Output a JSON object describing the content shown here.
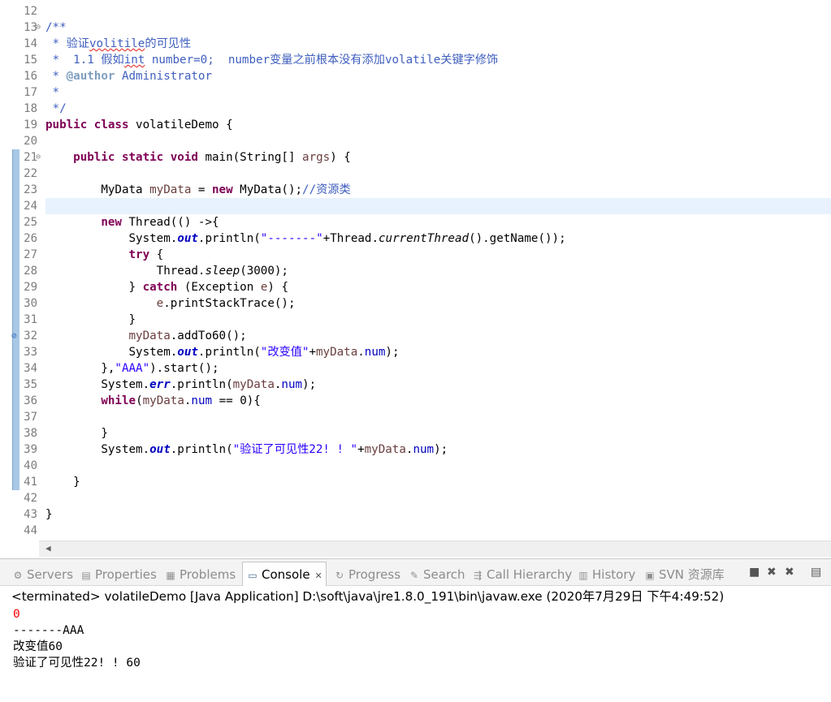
{
  "editor": {
    "line_numbers": [
      "12",
      "13",
      "14",
      "15",
      "16",
      "17",
      "18",
      "19",
      "20",
      "21",
      "22",
      "23",
      "24",
      "25",
      "26",
      "27",
      "28",
      "29",
      "30",
      "31",
      "32",
      "33",
      "34",
      "35",
      "36",
      "37",
      "38",
      "39",
      "40",
      "41",
      "42",
      "43",
      "44"
    ],
    "lines": {
      "l13": "/**",
      "l14a": " * 验证",
      "l14b": "volitile",
      "l14c": "的可见性",
      "l15a": " *  1.1 假如",
      "l15b": "int",
      "l15c": " number=0;  number变量之前根本没有添加volatile关键字修饰",
      "l16a": " * ",
      "l16b": "@author",
      "l16c": " Administrator",
      "l17": " *",
      "l18": " */",
      "l19a": "public class",
      "l19b": " volatileDemo {",
      "l21a": "    ",
      "l21b": "public static void",
      "l21c": " main(String[] ",
      "l21d": "args",
      "l21e": ") {",
      "l23a": "        MyData ",
      "l23b": "myData",
      "l23c": " = ",
      "l23d": "new",
      "l23e": " MyData();",
      "l23f": "//资源类",
      "l25a": "        ",
      "l25b": "new",
      "l25c": " Thread(() ->{",
      "l26a": "            System.",
      "l26b": "out",
      "l26c": ".println(",
      "l26d": "\"-------\"",
      "l26e": "+Thread.",
      "l26f": "currentThread",
      "l26g": "().getName());",
      "l27a": "            ",
      "l27b": "try",
      "l27c": " {",
      "l28a": "                Thread.",
      "l28b": "sleep",
      "l28c": "(3000);",
      "l29a": "            } ",
      "l29b": "catch",
      "l29c": " (Exception ",
      "l29d": "e",
      "l29e": ") {",
      "l30a": "                ",
      "l30b": "e",
      "l30c": ".printStackTrace();",
      "l31": "            }",
      "l32a": "            ",
      "l32b": "myData",
      "l32c": ".addTo60();",
      "l33a": "            System.",
      "l33b": "out",
      "l33c": ".println(",
      "l33d": "\"改变值\"",
      "l33e": "+",
      "l33f": "myData",
      "l33g": ".",
      "l33h": "num",
      "l33i": ");",
      "l34a": "        },",
      "l34b": "\"AAA\"",
      "l34c": ").start();",
      "l35a": "        System.",
      "l35b": "err",
      "l35c": ".println(",
      "l35d": "myData",
      "l35e": ".",
      "l35f": "num",
      "l35g": ");",
      "l36a": "        ",
      "l36b": "while",
      "l36c": "(",
      "l36d": "myData",
      "l36e": ".",
      "l36f": "num",
      "l36g": " == 0){",
      "l38": "        }",
      "l39a": "        System.",
      "l39b": "out",
      "l39c": ".println(",
      "l39d": "\"验证了可见性22! ! \"",
      "l39e": "+",
      "l39f": "myData",
      "l39g": ".",
      "l39h": "num",
      "l39i": ");",
      "l41": "    }",
      "l43": "}"
    }
  },
  "panel": {
    "tabs": [
      {
        "label": "Servers",
        "icon": "servers-icon"
      },
      {
        "label": "Properties",
        "icon": "properties-icon"
      },
      {
        "label": "Problems",
        "icon": "problems-icon"
      },
      {
        "label": "Console",
        "icon": "console-icon",
        "active": true
      },
      {
        "label": "Progress",
        "icon": "progress-icon"
      },
      {
        "label": "Search",
        "icon": "search-icon"
      },
      {
        "label": "Call Hierarchy",
        "icon": "call-hierarchy-icon"
      },
      {
        "label": "History",
        "icon": "history-icon"
      },
      {
        "label": "SVN 资源库",
        "icon": "svn-repository-icon"
      }
    ],
    "console": {
      "header": "<terminated> volatileDemo [Java Application] D:\\soft\\java\\jre1.8.0_191\\bin\\javaw.exe (2020年7月29日 下午4:49:52)",
      "output": [
        "0",
        "-------AAA",
        "改变值60",
        "验证了可见性22! ! 60"
      ]
    }
  },
  "colors": {
    "keyword": "#7f0055",
    "comment": "#3f5fbf",
    "string": "#2a00ff",
    "field": "#0000c0",
    "local_var": "#6a3e3e",
    "stderr": "#ff0000",
    "current_line": "#e8f2fe"
  }
}
